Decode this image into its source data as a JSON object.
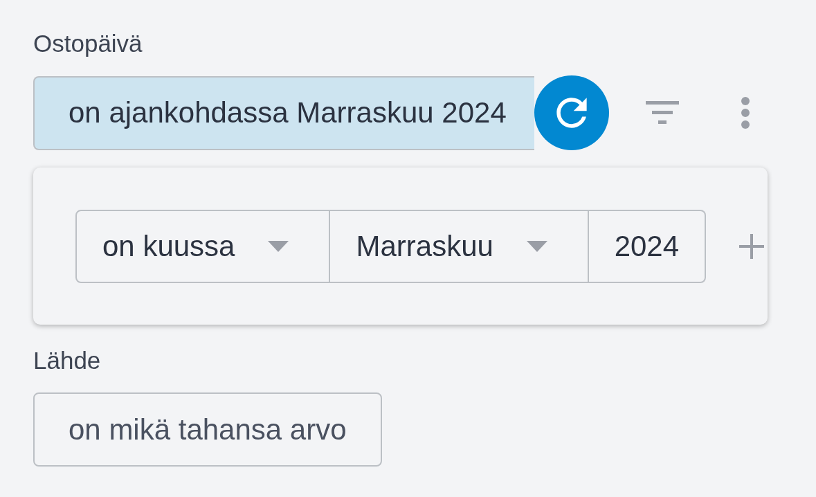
{
  "filters": [
    {
      "label": "Ostopäivä",
      "value": "on ajankohdassa Marraskuu 2024",
      "selected": true,
      "expanded": true,
      "editor": {
        "segments": [
          {
            "kind": "dropdown",
            "value": "on kuussa"
          },
          {
            "kind": "dropdown",
            "value": "Marraskuu"
          },
          {
            "kind": "input",
            "value": "2024"
          }
        ]
      }
    },
    {
      "label": "Lähde",
      "value": "on mikä tahansa arvo",
      "selected": false,
      "expanded": false
    }
  ]
}
